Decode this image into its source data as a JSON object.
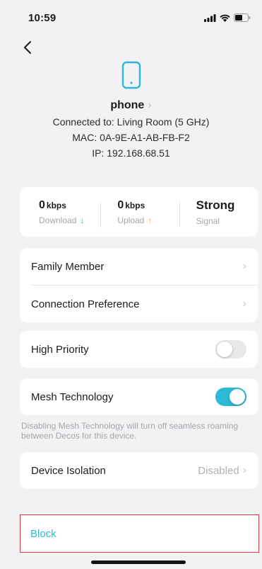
{
  "status_bar": {
    "time": "10:59",
    "icons": [
      "signal-icon",
      "wifi-icon",
      "battery-icon"
    ]
  },
  "header": {
    "back_icon": "chevron-left-icon"
  },
  "device": {
    "icon": "phone-icon",
    "name": "phone",
    "connected_to": "Connected to: Living Room (5 GHz)",
    "mac": "MAC: 0A-9E-A1-AB-FB-F2",
    "ip": "IP: 192.168.68.51"
  },
  "stats": {
    "download": {
      "value": "0",
      "unit": "kbps",
      "label": "Download",
      "arrow": "↓"
    },
    "upload": {
      "value": "0",
      "unit": "kbps",
      "label": "Upload",
      "arrow": "↑"
    },
    "signal": {
      "value": "Strong",
      "label": "Signal"
    }
  },
  "menu": {
    "family_member": "Family Member",
    "connection_preference": "Connection Preference"
  },
  "settings": {
    "high_priority": {
      "label": "High Priority",
      "enabled": false
    },
    "mesh_technology": {
      "label": "Mesh Technology",
      "enabled": true
    },
    "mesh_note": "Disabling Mesh Technology will turn off seamless roaming between Decos for this device.",
    "device_isolation": {
      "label": "Device Isolation",
      "value": "Disabled"
    }
  },
  "block": {
    "label": "Block"
  },
  "colors": {
    "accent": "#2db8d8",
    "highlight_border": "#d43c46",
    "download_arrow": "#2fbe6b",
    "upload_arrow": "#f0a030"
  }
}
